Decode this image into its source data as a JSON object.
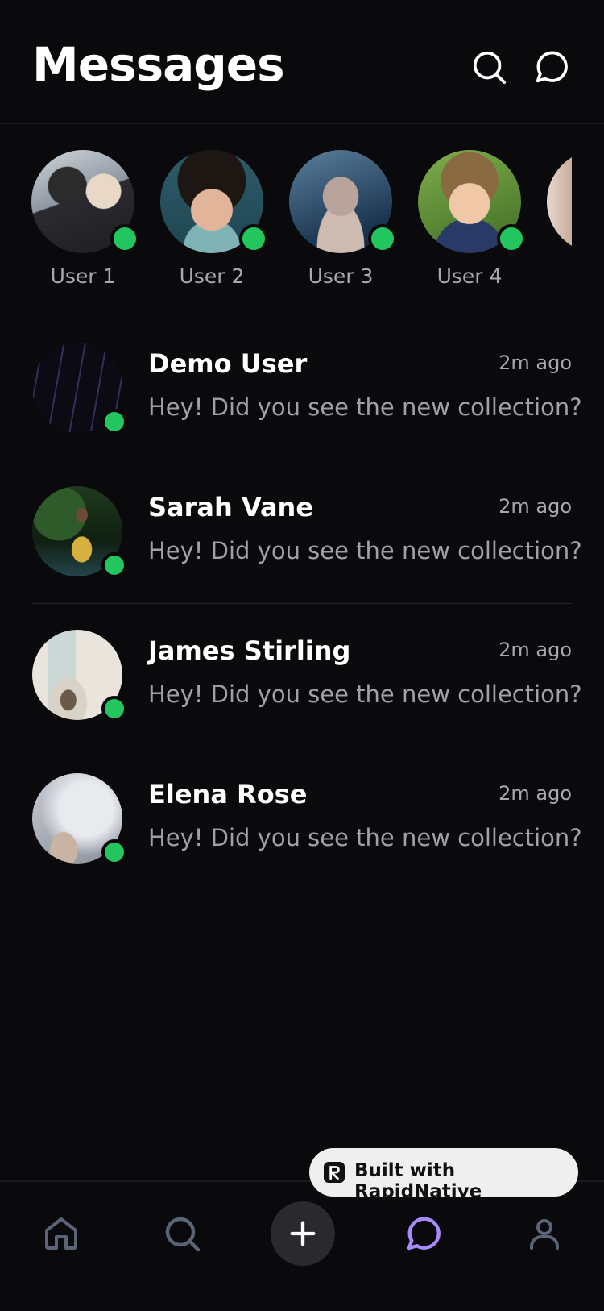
{
  "header": {
    "title": "Messages",
    "search_icon": "search-icon",
    "new_chat_icon": "chat-bubble-icon"
  },
  "stories": [
    {
      "label": "User 1",
      "online": true
    },
    {
      "label": "User 2",
      "online": true
    },
    {
      "label": "User 3",
      "online": true
    },
    {
      "label": "User 4",
      "online": true
    }
  ],
  "conversations": [
    {
      "name": "Demo User",
      "time": "2m ago",
      "message": "Hey! Did you see the new collection?",
      "online": true
    },
    {
      "name": "Sarah Vane",
      "time": "2m ago",
      "message": "Hey! Did you see the new collection?",
      "online": true
    },
    {
      "name": "James Stirling",
      "time": "2m ago",
      "message": "Hey! Did you see the new collection?",
      "online": true
    },
    {
      "name": "Elena Rose",
      "time": "2m ago",
      "message": "Hey! Did you see the new collection?",
      "online": true
    }
  ],
  "badge": {
    "label": "Built with RapidNative"
  },
  "tabbar": {
    "items": [
      "home-icon",
      "search-icon",
      "plus-icon",
      "chat-bubble-icon",
      "user-icon"
    ],
    "active": "chat-bubble-icon"
  },
  "colors": {
    "background": "#0a0a0c",
    "online": "#22c55e",
    "accent": "#a78bfa",
    "icon": "#5b6477"
  }
}
